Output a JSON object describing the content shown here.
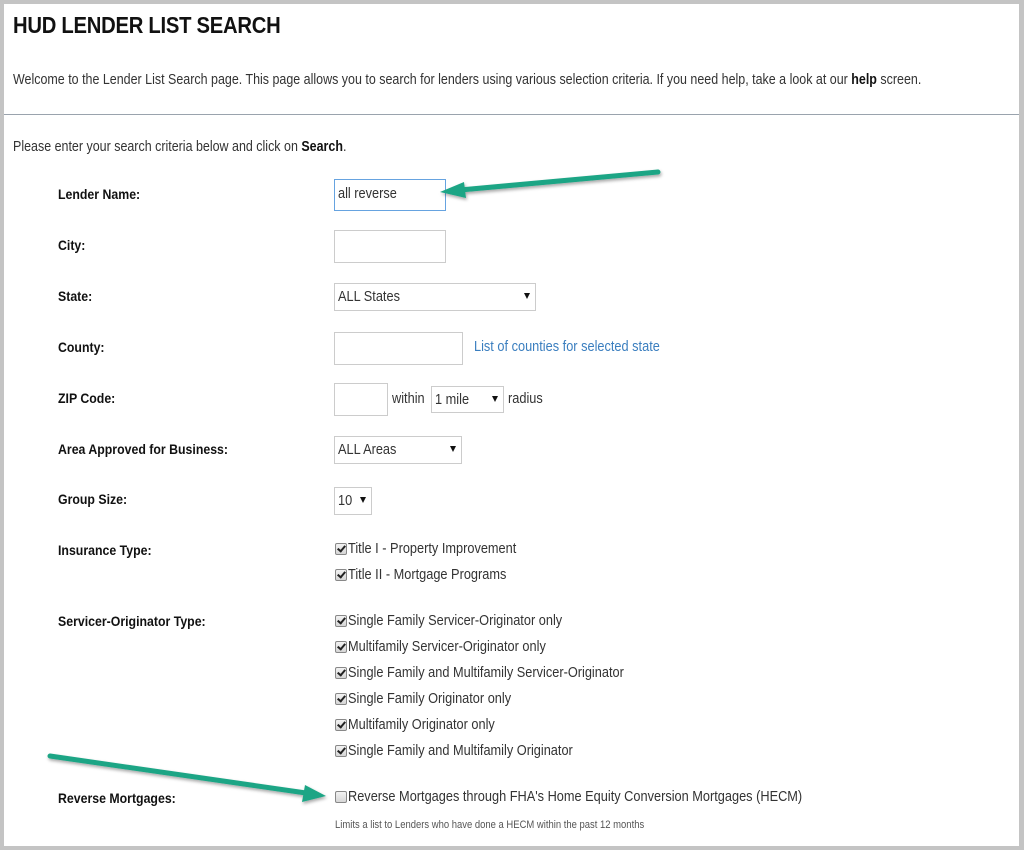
{
  "page": {
    "title": "HUD LENDER LIST SEARCH",
    "intro_text": "Welcome to the Lender List Search page. This page allows you to search for lenders using various selection criteria. If you need help, take a look at our ",
    "intro_link": "help",
    "intro_suffix": " screen.",
    "instructions_prefix": "Please enter your search criteria below and click on ",
    "instructions_bold": "Search",
    "instructions_suffix": "."
  },
  "form": {
    "lender_name": {
      "label": "Lender Name:",
      "value": "all reverse"
    },
    "city": {
      "label": "City:",
      "value": ""
    },
    "state": {
      "label": "State:",
      "selected": "ALL States"
    },
    "county": {
      "label": "County:",
      "value": "",
      "link": "List of counties for selected state"
    },
    "zip": {
      "label": "ZIP Code:",
      "value": "",
      "within": "within",
      "radius_selected": "1 mile",
      "radius": "radius"
    },
    "area": {
      "label": "Area Approved for Business:",
      "selected": "ALL Areas"
    },
    "group_size": {
      "label": "Group Size:",
      "selected": "10"
    },
    "insurance_type": {
      "label": "Insurance Type:",
      "options": [
        {
          "label": "Title I - Property Improvement",
          "checked": true
        },
        {
          "label": "Title II - Mortgage Programs",
          "checked": true
        }
      ]
    },
    "servicer_originator": {
      "label": "Servicer-Originator Type:",
      "options": [
        {
          "label": "Single Family Servicer-Originator only",
          "checked": true
        },
        {
          "label": "Multifamily Servicer-Originator only",
          "checked": true
        },
        {
          "label": "Single Family and Multifamily Servicer-Originator",
          "checked": true
        },
        {
          "label": "Single Family Originator only",
          "checked": true
        },
        {
          "label": "Multifamily Originator only",
          "checked": true
        },
        {
          "label": "Single Family and Multifamily Originator",
          "checked": true
        }
      ]
    },
    "reverse_mortgages": {
      "label": "Reverse Mortgages:",
      "option": {
        "label": "Reverse Mortgages through FHA's Home Equity Conversion Mortgages (HECM)",
        "checked": false
      },
      "hint": "Limits a list to Lenders who have done a HECM within the past 12 months"
    }
  },
  "annotations": {
    "arrow_color": "#1aa585"
  }
}
